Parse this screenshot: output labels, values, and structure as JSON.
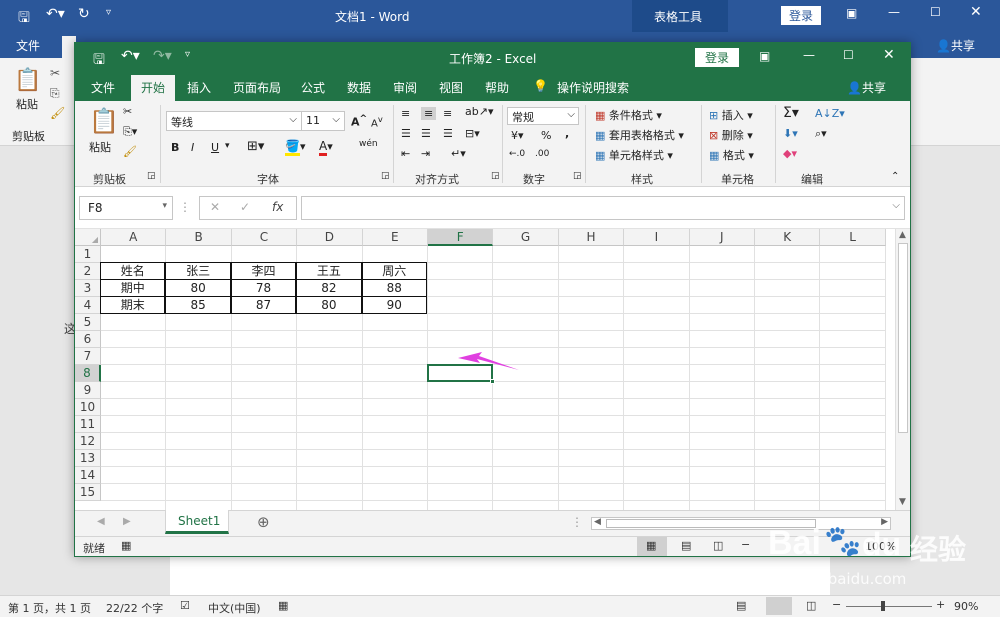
{
  "word": {
    "title": "文档1  -  Word",
    "tool_context": "表格工具",
    "login_label": "登录",
    "share_label": "共享",
    "tabs": [
      "文件",
      "开始"
    ],
    "clipboard_label": "粘贴",
    "clipboard_group": "剪贴板",
    "side_glyph": "这",
    "status": {
      "page": "第 1 页，共 1 页",
      "words": "22/22 个字",
      "lang": "中文(中国)",
      "zoom": "90%"
    }
  },
  "excel": {
    "title": "工作簿2  -  Excel",
    "login_label": "登录",
    "share_label": "共享",
    "tabs": [
      "文件",
      "开始",
      "插入",
      "页面布局",
      "公式",
      "数据",
      "审阅",
      "视图",
      "帮助"
    ],
    "tell_me": "操作说明搜索",
    "ribbon": {
      "paste_label": "粘贴",
      "clipboard_group": "剪贴板",
      "font_name": "等线",
      "font_size": "11",
      "font_group": "字体",
      "align_group": "对齐方式",
      "number_format": "常规",
      "number_group": "数字",
      "cond_format": "条件格式",
      "table_format": "套用表格格式",
      "cell_style": "单元格样式",
      "style_group": "样式",
      "insert_label": "插入",
      "delete_label": "删除",
      "format_label": "格式",
      "cells_group": "单元格",
      "edit_group": "编辑",
      "bold": "B",
      "italic": "I",
      "underline": "U",
      "grow_font": "A",
      "shrink_font": "A",
      "font_color": "A",
      "phonetic": "wén",
      "currency": "¥",
      "percent": "%",
      "comma": ",",
      "inc_decimal": "←.0",
      "dec_decimal": ".00",
      "sigma": "Σ",
      "sort": "A↓Z",
      "find": "⌕"
    },
    "name_box": "F8",
    "fx": "fx",
    "columns": [
      "A",
      "B",
      "C",
      "D",
      "E",
      "F",
      "G",
      "H",
      "I",
      "J",
      "K",
      "L"
    ],
    "rows": [
      "1",
      "2",
      "3",
      "4",
      "5",
      "6",
      "7",
      "8",
      "9",
      "10",
      "11",
      "12",
      "13",
      "14",
      "15"
    ],
    "table": [
      [
        "姓名",
        "张三",
        "李四",
        "王五",
        "周六"
      ],
      [
        "期中",
        "80",
        "78",
        "82",
        "88"
      ],
      [
        "期末",
        "85",
        "87",
        "80",
        "90"
      ]
    ],
    "selected_cell": "F8",
    "sheet_tab": "Sheet1",
    "add_sheet": "⊕",
    "status_ready": "就绪",
    "zoom": "100%",
    "accent": "#217346",
    "arrow_color": "#e040e0"
  },
  "watermark": {
    "brand": "Bai",
    "brand2": "du",
    "cn": "经验",
    "url": "jingyan.baidu.com"
  }
}
